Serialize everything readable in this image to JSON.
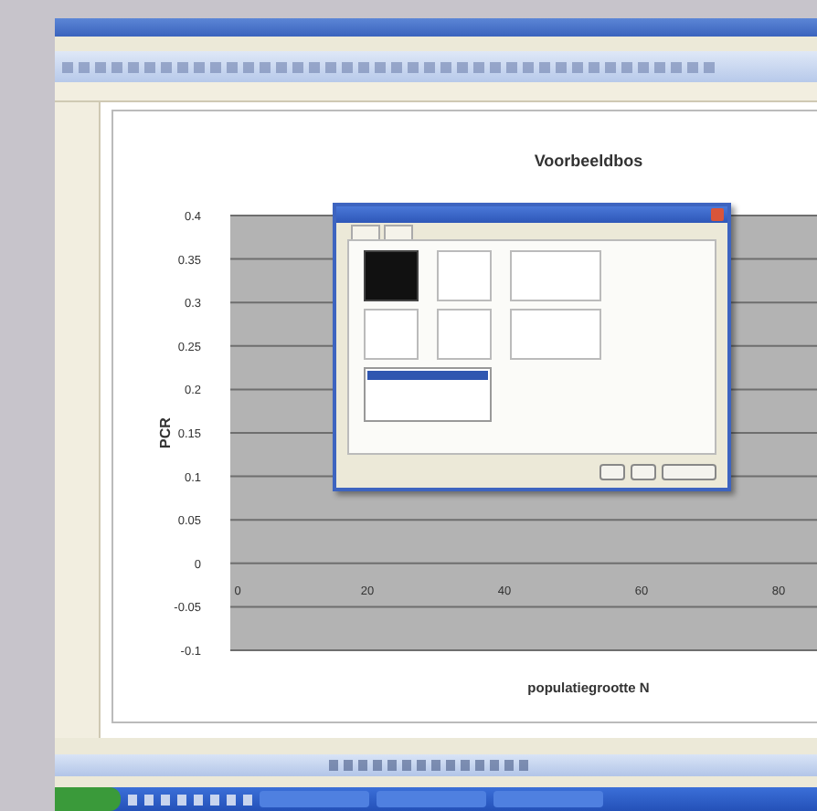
{
  "chart": {
    "chart_data": {
      "type": "line",
      "grid": true,
      "title": "Voorbeeldbos",
      "xlabel": "populatiegrootte N",
      "ylabel": "PCR",
      "xlim": [
        0,
        80
      ],
      "ylim": [
        -0.1,
        0.4
      ],
      "xticks": [
        {
          "value": 0,
          "label": "0"
        },
        {
          "value": 20,
          "label": "20"
        },
        {
          "value": 40,
          "label": "40"
        },
        {
          "value": 60,
          "label": "60"
        },
        {
          "value": 80,
          "label": "80"
        }
      ],
      "yticks": [
        {
          "value": 0.4,
          "label": "0.4"
        },
        {
          "value": 0.35,
          "label": "0.35"
        },
        {
          "value": 0.3,
          "label": "0.3"
        },
        {
          "value": 0.25,
          "label": "0.25"
        },
        {
          "value": 0.2,
          "label": "0.2"
        },
        {
          "value": 0.15,
          "label": "0.15"
        },
        {
          "value": 0.1,
          "label": "0.1"
        },
        {
          "value": 0.05,
          "label": "0.05"
        },
        {
          "value": 0,
          "label": "0"
        },
        {
          "value": -0.05,
          "label": "-0.05"
        },
        {
          "value": -0.1,
          "label": "-0.1"
        }
      ]
    }
  },
  "dialog": {
    "thumbnails": [
      {
        "selected": true
      },
      {
        "selected": false
      },
      {
        "selected": false
      },
      {
        "selected": false
      },
      {
        "selected": false
      },
      {
        "selected": false
      }
    ],
    "list_items": [
      {
        "selected": true
      }
    ]
  }
}
